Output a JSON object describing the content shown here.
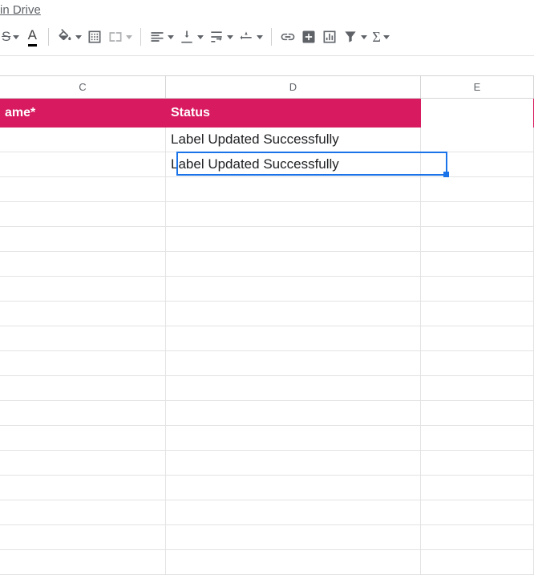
{
  "top_link": "in Drive",
  "toolbar": {
    "strikethrough": "S",
    "text_color": "A"
  },
  "columns": {
    "c": "C",
    "d": "D",
    "e": "E"
  },
  "headers": {
    "c": "ame*",
    "d": "Status"
  },
  "rows": [
    {
      "c": "",
      "d": "Label Updated Successfully",
      "e": ""
    },
    {
      "c": "",
      "d": "Label Updated Successfully",
      "e": ""
    }
  ],
  "selected": {
    "col": "d",
    "row": 1
  }
}
